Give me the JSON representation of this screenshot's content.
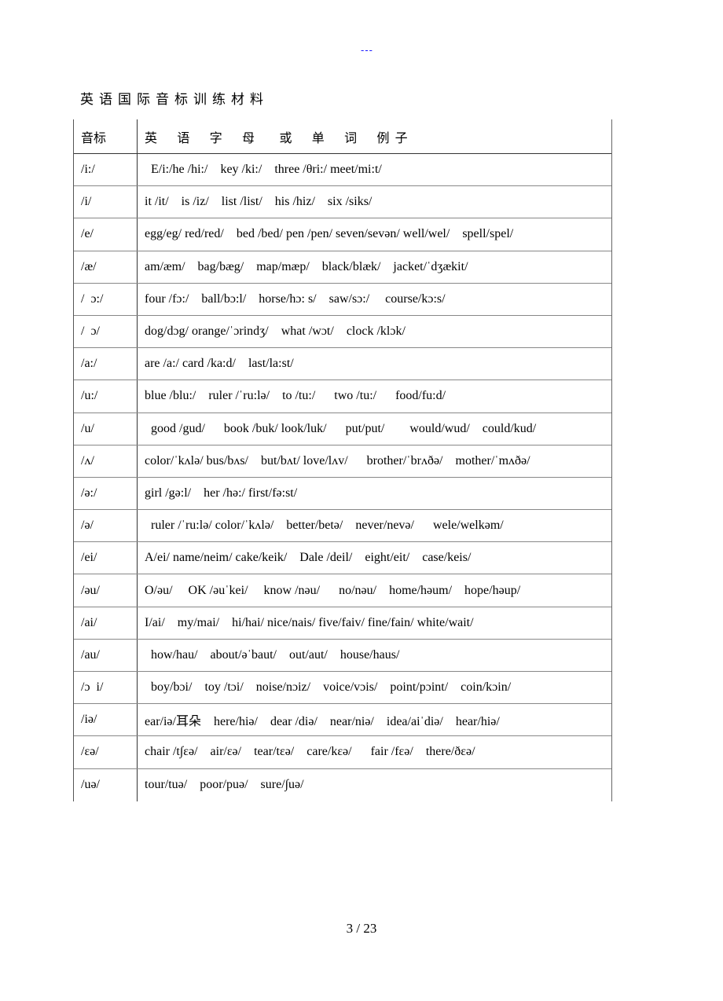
{
  "header_mark": "---",
  "title": "英语国际音标训练材料",
  "table": {
    "header": {
      "symbol": "音标",
      "examples": "英    语    字    母     或    单    词    例 子"
    },
    "rows": [
      {
        "symbol": "/i:/",
        "examples": "  E/i:/he /hi:/    key /ki:/    three /θri:/ meet/mi:t/"
      },
      {
        "symbol": "/i/",
        "examples": "it /it/    is /iz/    list /list/    his /hiz/    six /siks/"
      },
      {
        "symbol": "/e/",
        "examples": "egg/eg/ red/red/    bed /bed/ pen /pen/ seven/sevən/ well/wel/    spell/spel/"
      },
      {
        "symbol": "/æ/",
        "examples": "am/æm/    bag/bæg/    map/mæp/    black/blæk/    jacket/ˈdʒækit/"
      },
      {
        "symbol": "/  ɔ:/",
        "examples": "four /fɔ:/    ball/bɔ:l/    horse/hɔ: s/    saw/sɔ:/     course/kɔ:s/"
      },
      {
        "symbol": "/  ɔ/",
        "examples": "dog/dɔg/ orange/ˈɔrindʒ/    what /wɔt/    clock /klɔk/"
      },
      {
        "symbol": "/a:/",
        "examples": "are /a:/ card /ka:d/    last/la:st/"
      },
      {
        "symbol": "/u:/",
        "examples": "blue /blu:/    ruler /ˈru:lə/    to /tu:/      two /tu:/      food/fu:d/"
      },
      {
        "symbol": "/u/",
        "examples": "  good /gud/      book /buk/ look/luk/      put/put/        would/wud/    could/kud/"
      },
      {
        "symbol": "/ʌ/",
        "examples": "color/ˈkʌlə/ bus/bʌs/    but/bʌt/ love/lʌv/      brother/ˈbrʌðə/    mother/ˈmʌðə/"
      },
      {
        "symbol": "/ə:/",
        "examples": "girl /gə:l/    her /hə:/ first/fə:st/"
      },
      {
        "symbol": "/ə/",
        "examples": "  ruler /ˈru:lə/ color/ˈkʌlə/    better/betə/    never/nevə/      wele/welkəm/"
      },
      {
        "symbol": "/ei/",
        "examples": "A/ei/ name/neim/ cake/keik/    Dale /deil/    eight/eit/    case/keis/"
      },
      {
        "symbol": "/əu/",
        "examples": "O/əu/     OK /əuˈkei/     know /nəu/      no/nəu/    home/həum/    hope/həup/"
      },
      {
        "symbol": "/ai/",
        "examples": "I/ai/    my/mai/    hi/hai/ nice/nais/ five/faiv/ fine/fain/ white/wait/"
      },
      {
        "symbol": "/au/",
        "examples": "  how/hau/    about/əˈbaut/    out/aut/    house/haus/"
      },
      {
        "symbol": "/ɔ  i/",
        "examples": "  boy/bɔi/    toy /tɔi/    noise/nɔiz/    voice/vɔis/    point/pɔint/    coin/kɔin/"
      },
      {
        "symbol": "/iə/",
        "examples": "ear/iə/耳朵    here/hiə/    dear /diə/    near/niə/    idea/aiˈdiə/    hear/hiə/"
      },
      {
        "symbol": "/εə/",
        "examples": "chair /t∫εə/    air/εə/    tear/tεə/    care/kεə/      fair /fεə/    there/ðεə/"
      },
      {
        "symbol": "/uə/",
        "examples": "tour/tuə/    poor/puə/    sure/∫uə/"
      }
    ]
  },
  "footer": {
    "page_label": "3  / 23"
  }
}
